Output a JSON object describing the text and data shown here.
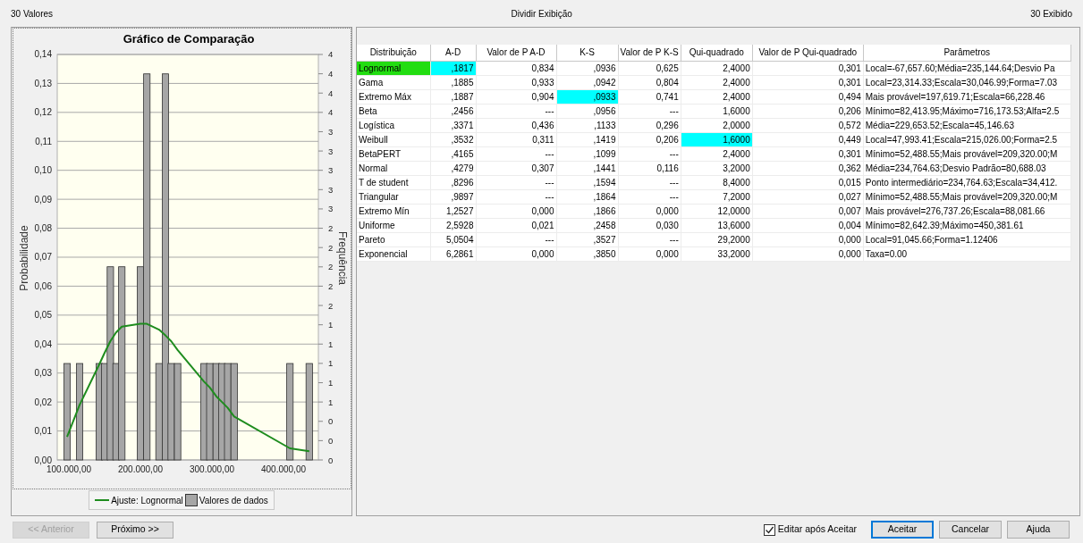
{
  "header": {
    "left": "30 Valores",
    "center": "Dividir Exibição",
    "right": "30 Exibido"
  },
  "chart": {
    "chart_data": {
      "type": "bar",
      "title": "Gráfico de Comparação",
      "ylabel": "Probabilidade",
      "x": [
        97500,
        115000,
        142500,
        150000,
        158000,
        166000,
        174000,
        200000,
        209000,
        226000,
        235000,
        243000,
        252000,
        289000,
        297000,
        306000,
        314000,
        322000,
        331000,
        409000,
        436000
      ],
      "series": [
        {
          "name": "Valores de dados",
          "type": "bar",
          "color": "#a6a6a6",
          "values": [
            0.0333,
            0.0333,
            0.0333,
            0.0333,
            0.0667,
            0.0333,
            0.0667,
            0.0667,
            0.1333,
            0.0333,
            0.1333,
            0.0333,
            0.0333,
            0.0333,
            0.0333,
            0.0333,
            0.0333,
            0.0333,
            0.0333,
            0.0333,
            0.0333
          ]
        },
        {
          "name": "Ajuste: Lognormal",
          "type": "line",
          "color": "#1e8c1e",
          "values": [
            0.008,
            0.019,
            0.033,
            0.037,
            0.041,
            0.044,
            0.046,
            0.047,
            0.047,
            0.045,
            0.043,
            0.041,
            0.038,
            0.027,
            0.025,
            0.022,
            0.02,
            0.018,
            0.015,
            0.004,
            0.003
          ]
        }
      ],
      "grid": true,
      "xlim": [
        83750,
        448750
      ],
      "ylim": [
        0,
        0.14
      ],
      "xticks": [
        {
          "value": 100000,
          "label": "100.000,00"
        },
        {
          "value": 200000,
          "label": "200.000,00"
        },
        {
          "value": 300000,
          "label": "300.000,00"
        },
        {
          "value": 400000,
          "label": "400.000,00"
        }
      ],
      "yticks": [
        {
          "value": 0,
          "label": "0,00"
        },
        {
          "value": 0.01,
          "label": "0,01"
        },
        {
          "value": 0.02,
          "label": "0,02"
        },
        {
          "value": 0.03,
          "label": "0,03"
        },
        {
          "value": 0.04,
          "label": "0,04"
        },
        {
          "value": 0.05,
          "label": "0,05"
        },
        {
          "value": 0.06,
          "label": "0,06"
        },
        {
          "value": 0.07,
          "label": "0,07"
        },
        {
          "value": 0.08,
          "label": "0,08"
        },
        {
          "value": 0.09,
          "label": "0,09"
        },
        {
          "value": 0.1,
          "label": "0,10"
        },
        {
          "value": 0.11,
          "label": "0,11"
        },
        {
          "value": 0.12,
          "label": "0,12"
        },
        {
          "value": 0.13,
          "label": "0,13"
        },
        {
          "value": 0.14,
          "label": "0,14"
        }
      ]
    },
    "right_axis": {
      "label": "Frequência",
      "ticks": [
        "4",
        "4",
        "4",
        "4",
        "3",
        "3",
        "3",
        "3",
        "3",
        "2",
        "2",
        "2",
        "2",
        "2",
        "1",
        "1",
        "1",
        "1",
        "1",
        "0",
        "0",
        "0"
      ]
    }
  },
  "table": {
    "columns": [
      "Distribuição",
      "A-D",
      "Valor de P A-D",
      "K-S",
      "Valor de P K-S",
      "Qui-quadrado",
      "Valor de P Qui-quadrado",
      "Parâmetros"
    ],
    "rows": [
      {
        "distribution": "Lognormal",
        "selected": true,
        "values": [
          ",1817",
          "0,834",
          ",0936",
          "0,625",
          "2,4000",
          "0,301",
          "Local=-67,657.60;Média=235,144.64;Desvio Pa"
        ],
        "best": [
          true,
          false,
          false,
          false,
          false,
          false,
          false
        ]
      },
      {
        "distribution": "Gama",
        "selected": false,
        "values": [
          ",1885",
          "0,933",
          ",0942",
          "0,804",
          "2,4000",
          "0,301",
          "Local=23,314.33;Escala=30,046.99;Forma=7.03"
        ],
        "best": [
          false,
          false,
          false,
          false,
          false,
          false,
          false
        ]
      },
      {
        "distribution": "Extremo Máx",
        "selected": false,
        "values": [
          ",1887",
          "0,904",
          ",0933",
          "0,741",
          "2,4000",
          "0,494",
          "Mais provável=197,619.71;Escala=66,228.46"
        ],
        "best": [
          false,
          false,
          true,
          false,
          false,
          false,
          false
        ]
      },
      {
        "distribution": "Beta",
        "selected": false,
        "values": [
          ",2456",
          "---",
          ",0956",
          "---",
          "1,6000",
          "0,206",
          "Mínimo=82,413.95;Máximo=716,173.53;Alfa=2.5"
        ],
        "best": [
          false,
          false,
          false,
          false,
          false,
          false,
          false
        ]
      },
      {
        "distribution": "Logística",
        "selected": false,
        "values": [
          ",3371",
          "0,436",
          ",1133",
          "0,296",
          "2,0000",
          "0,572",
          "Média=229,653.52;Escala=45,146.63"
        ],
        "best": [
          false,
          false,
          false,
          false,
          false,
          false,
          false
        ]
      },
      {
        "distribution": "Weibull",
        "selected": false,
        "values": [
          ",3532",
          "0,311",
          ",1419",
          "0,206",
          "1,6000",
          "0,449",
          "Local=47,993.41;Escala=215,026.00;Forma=2.5"
        ],
        "best": [
          false,
          false,
          false,
          false,
          true,
          false,
          false
        ]
      },
      {
        "distribution": "BetaPERT",
        "selected": false,
        "values": [
          ",4165",
          "---",
          ",1099",
          "---",
          "2,4000",
          "0,301",
          "Mínimo=52,488.55;Mais provável=209,320.00;M"
        ],
        "best": [
          false,
          false,
          false,
          false,
          false,
          false,
          false
        ]
      },
      {
        "distribution": "Normal",
        "selected": false,
        "values": [
          ",4279",
          "0,307",
          ",1441",
          "0,116",
          "3,2000",
          "0,362",
          "Média=234,764.63;Desvio Padrão=80,688.03"
        ],
        "best": [
          false,
          false,
          false,
          false,
          false,
          false,
          false
        ]
      },
      {
        "distribution": "T de student",
        "selected": false,
        "values": [
          ",8296",
          "---",
          ",1594",
          "---",
          "8,4000",
          "0,015",
          "Ponto intermediário=234,764.63;Escala=34,412."
        ],
        "best": [
          false,
          false,
          false,
          false,
          false,
          false,
          false
        ]
      },
      {
        "distribution": "Triangular",
        "selected": false,
        "values": [
          ",9897",
          "---",
          ",1864",
          "---",
          "7,2000",
          "0,027",
          "Mínimo=52,488.55;Mais provável=209,320.00;M"
        ],
        "best": [
          false,
          false,
          false,
          false,
          false,
          false,
          false
        ]
      },
      {
        "distribution": "Extremo Mín",
        "selected": false,
        "values": [
          "1,2527",
          "0,000",
          ",1866",
          "0,000",
          "12,0000",
          "0,007",
          "Mais provável=276,737.26;Escala=88,081.66"
        ],
        "best": [
          false,
          false,
          false,
          false,
          false,
          false,
          false
        ]
      },
      {
        "distribution": "Uniforme",
        "selected": false,
        "values": [
          "2,5928",
          "0,021",
          ",2458",
          "0,030",
          "13,6000",
          "0,004",
          "Mínimo=82,642.39;Máximo=450,381.61"
        ],
        "best": [
          false,
          false,
          false,
          false,
          false,
          false,
          false
        ]
      },
      {
        "distribution": "Pareto",
        "selected": false,
        "values": [
          "5,0504",
          "---",
          ",3527",
          "---",
          "29,2000",
          "0,000",
          "Local=91,045.66;Forma=1.12406"
        ],
        "best": [
          false,
          false,
          false,
          false,
          false,
          false,
          false
        ]
      },
      {
        "distribution": "Exponencial",
        "selected": false,
        "values": [
          "6,2861",
          "0,000",
          ",3850",
          "0,000",
          "33,2000",
          "0,000",
          "Taxa=0.00"
        ],
        "best": [
          false,
          false,
          false,
          false,
          false,
          false,
          false
        ]
      }
    ]
  },
  "nav_buttons": [
    {
      "label": "<< Anterior",
      "disabled": true
    },
    {
      "label": "Próximo >>",
      "disabled": false
    }
  ],
  "edit_after_accept": {
    "label": "Editar após Aceitar",
    "checked": true
  },
  "buttons": [
    {
      "label": "Aceitar",
      "default": true
    },
    {
      "label": "Cancelar",
      "default": false
    },
    {
      "label": "Ajuda",
      "default": false
    }
  ]
}
